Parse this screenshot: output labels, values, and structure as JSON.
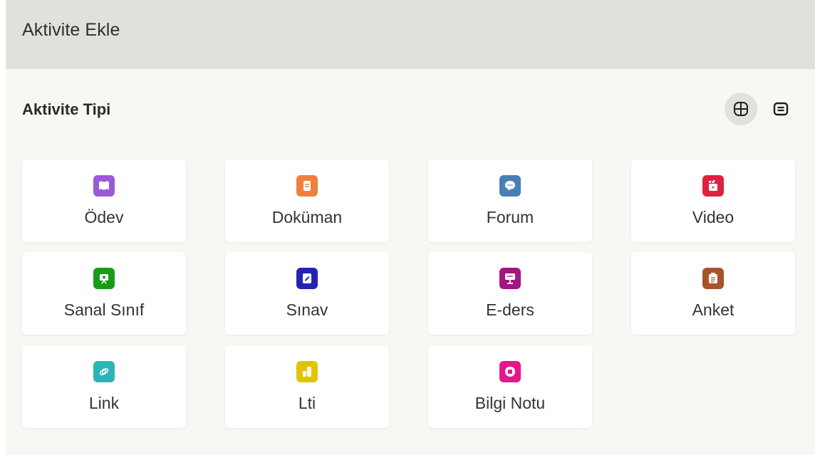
{
  "header": {
    "title": "Aktivite Ekle"
  },
  "section": {
    "title": "Aktivite Tipi"
  },
  "view_toggle": [
    {
      "name": "grid-view-icon",
      "active": true
    },
    {
      "name": "list-view-icon",
      "active": false
    }
  ],
  "activities": [
    {
      "label": "Ödev",
      "icon": "book-icon",
      "color": "#9b59d6"
    },
    {
      "label": "Doküman",
      "icon": "document-icon",
      "color": "#f07f3c"
    },
    {
      "label": "Forum",
      "icon": "chat-bubble-icon",
      "color": "#4a7fb5"
    },
    {
      "label": "Video",
      "icon": "video-clapper-icon",
      "color": "#e0203f"
    },
    {
      "label": "Sanal Sınıf",
      "icon": "virtual-classroom-icon",
      "color": "#1a9a1a"
    },
    {
      "label": "Sınav",
      "icon": "exam-icon",
      "color": "#2323b8"
    },
    {
      "label": "E-ders",
      "icon": "presentation-icon",
      "color": "#a3167f"
    },
    {
      "label": "Anket",
      "icon": "clipboard-icon",
      "color": "#a5542c"
    },
    {
      "label": "Link",
      "icon": "link-icon",
      "color": "#2ab6b6"
    },
    {
      "label": "Lti",
      "icon": "lti-icon",
      "color": "#e1c400"
    },
    {
      "label": "Bilgi Notu",
      "icon": "info-note-icon",
      "color": "#e5168a"
    }
  ]
}
